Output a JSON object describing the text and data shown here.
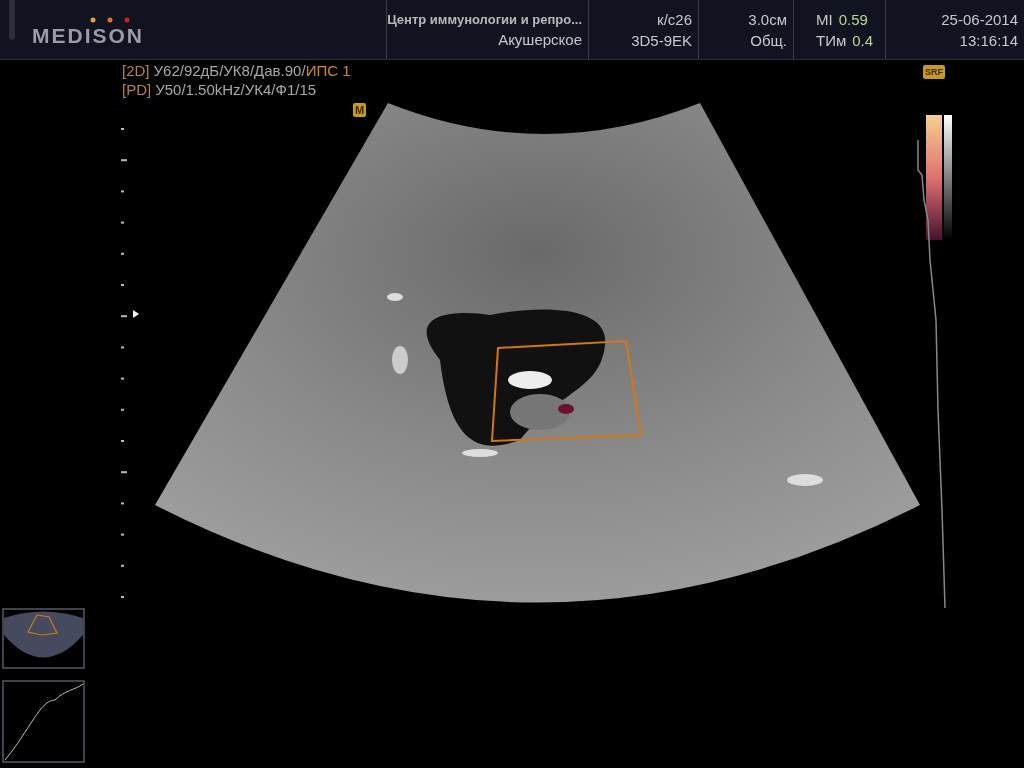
{
  "logo": {
    "text": "MEDISON"
  },
  "header": {
    "institution": "Центр иммунологии и репро...",
    "preset": "Акушерское",
    "frame_rate": "к/с26",
    "probe": "3D5-9EK",
    "depth": "3.0см",
    "mode": "Общ.",
    "mi_label": "MI",
    "mi_value": "0.59",
    "ti_label": "ТИм",
    "ti_value": "0.4",
    "date": "25-06-2014",
    "time": "13:16:14"
  },
  "params": [
    {
      "tag": "[2D]",
      "text": "У62/92дБ/УК8/Дав.90/",
      "highlight": "ИПС 1"
    },
    {
      "tag": "[PD]",
      "text": "У50/1.50kHz/УК4/Ф1/15"
    }
  ],
  "m_badge": "M",
  "srf_badge": "SRF"
}
